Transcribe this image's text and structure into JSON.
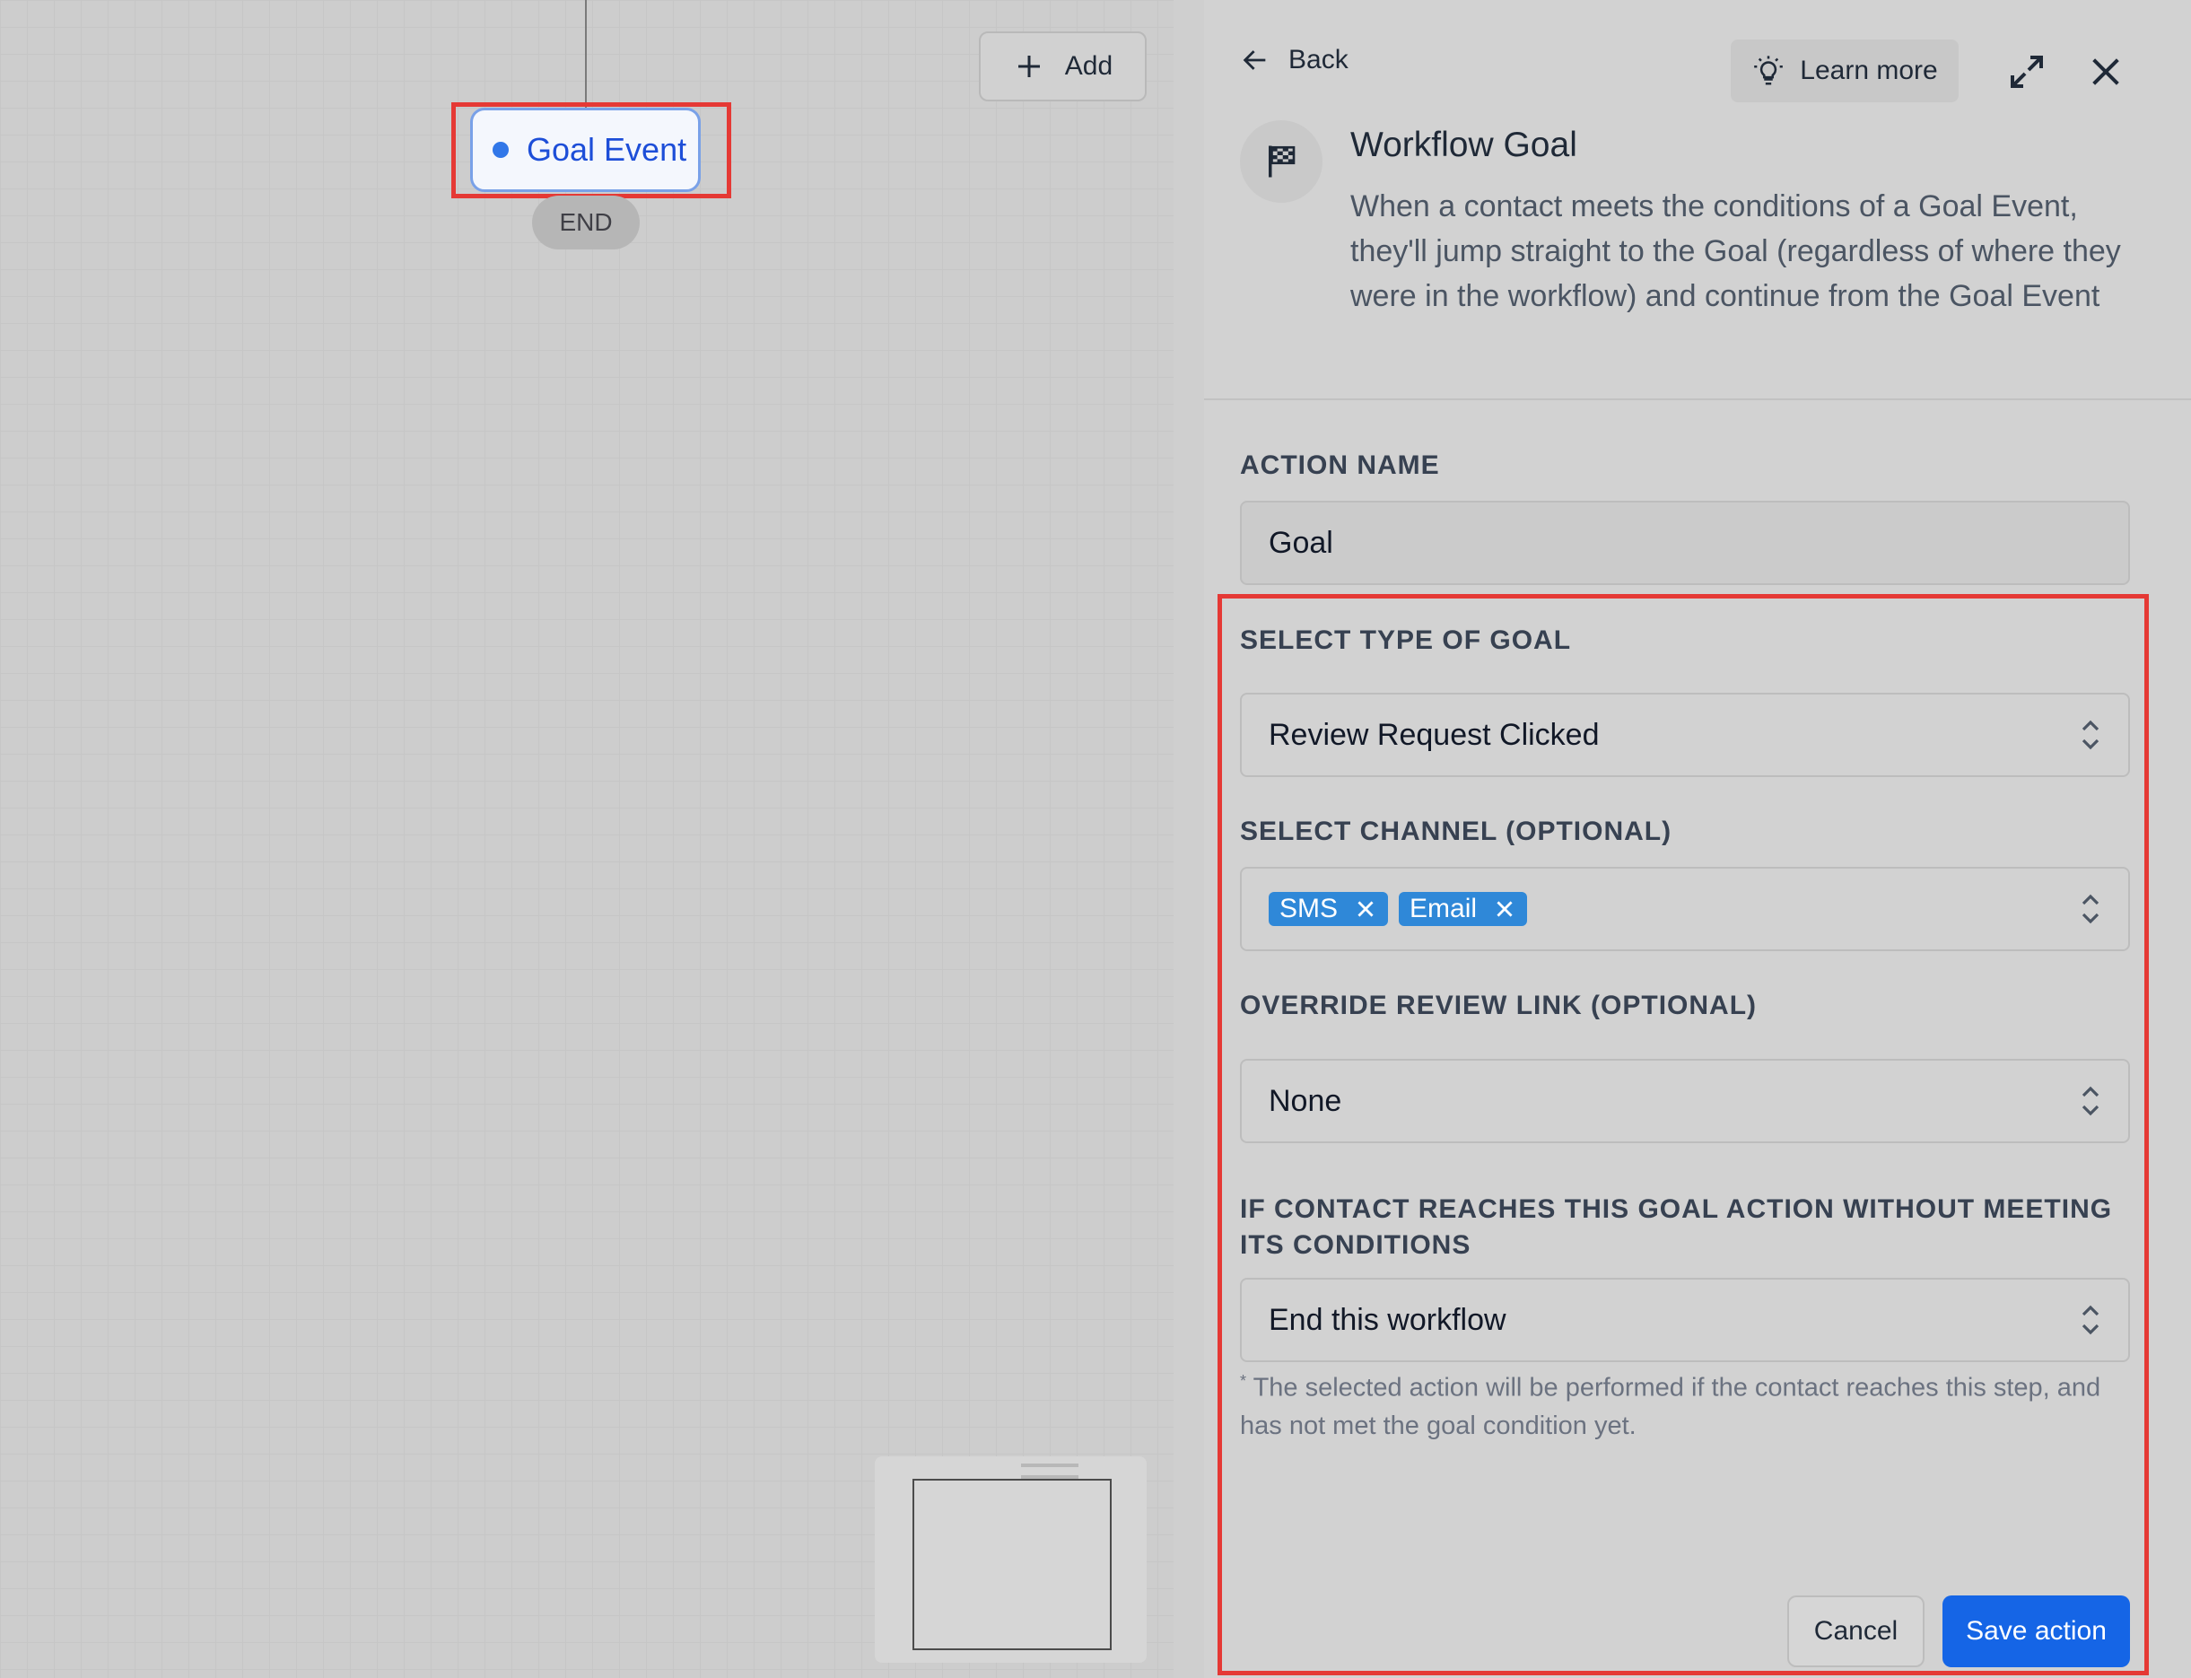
{
  "canvas": {
    "goal_node_label": "Goal Event",
    "end_label": "END",
    "add_label": "Add"
  },
  "panel": {
    "back_label": "Back",
    "learn_more_label": "Learn more",
    "title": "Workflow Goal",
    "description": "When a contact meets the conditions of a Goal Event, they'll jump straight to the Goal (regardless of where they were in the workflow) and continue from the Goal Event",
    "action_name": {
      "label": "ACTION NAME",
      "value": "Goal"
    },
    "goal_type": {
      "label": "SELECT TYPE OF GOAL",
      "value": "Review Request Clicked"
    },
    "channel": {
      "label": "SELECT CHANNEL (OPTIONAL)",
      "tags": [
        "SMS",
        "Email"
      ]
    },
    "override_link": {
      "label": "OVERRIDE REVIEW LINK (OPTIONAL)",
      "value": "None"
    },
    "no_condition": {
      "label": "IF CONTACT REACHES THIS GOAL ACTION WITHOUT MEETING ITS CONDITIONS",
      "value": "End this workflow"
    },
    "hint_mark": "*",
    "hint": "The selected action will be performed if the contact reaches this step, and has not met the goal condition yet.",
    "cancel_label": "Cancel",
    "save_label": "Save action"
  },
  "colors": {
    "primary": "#1565e6",
    "tag": "#2f88d8",
    "highlight": "#e53935",
    "node_text": "#1d4ed8"
  },
  "icons": [
    "plus-icon",
    "arrow-left-icon",
    "lightbulb-icon",
    "expand-icon",
    "close-icon",
    "flag-icon",
    "chevron-updown-icon",
    "tag-remove-icon"
  ]
}
